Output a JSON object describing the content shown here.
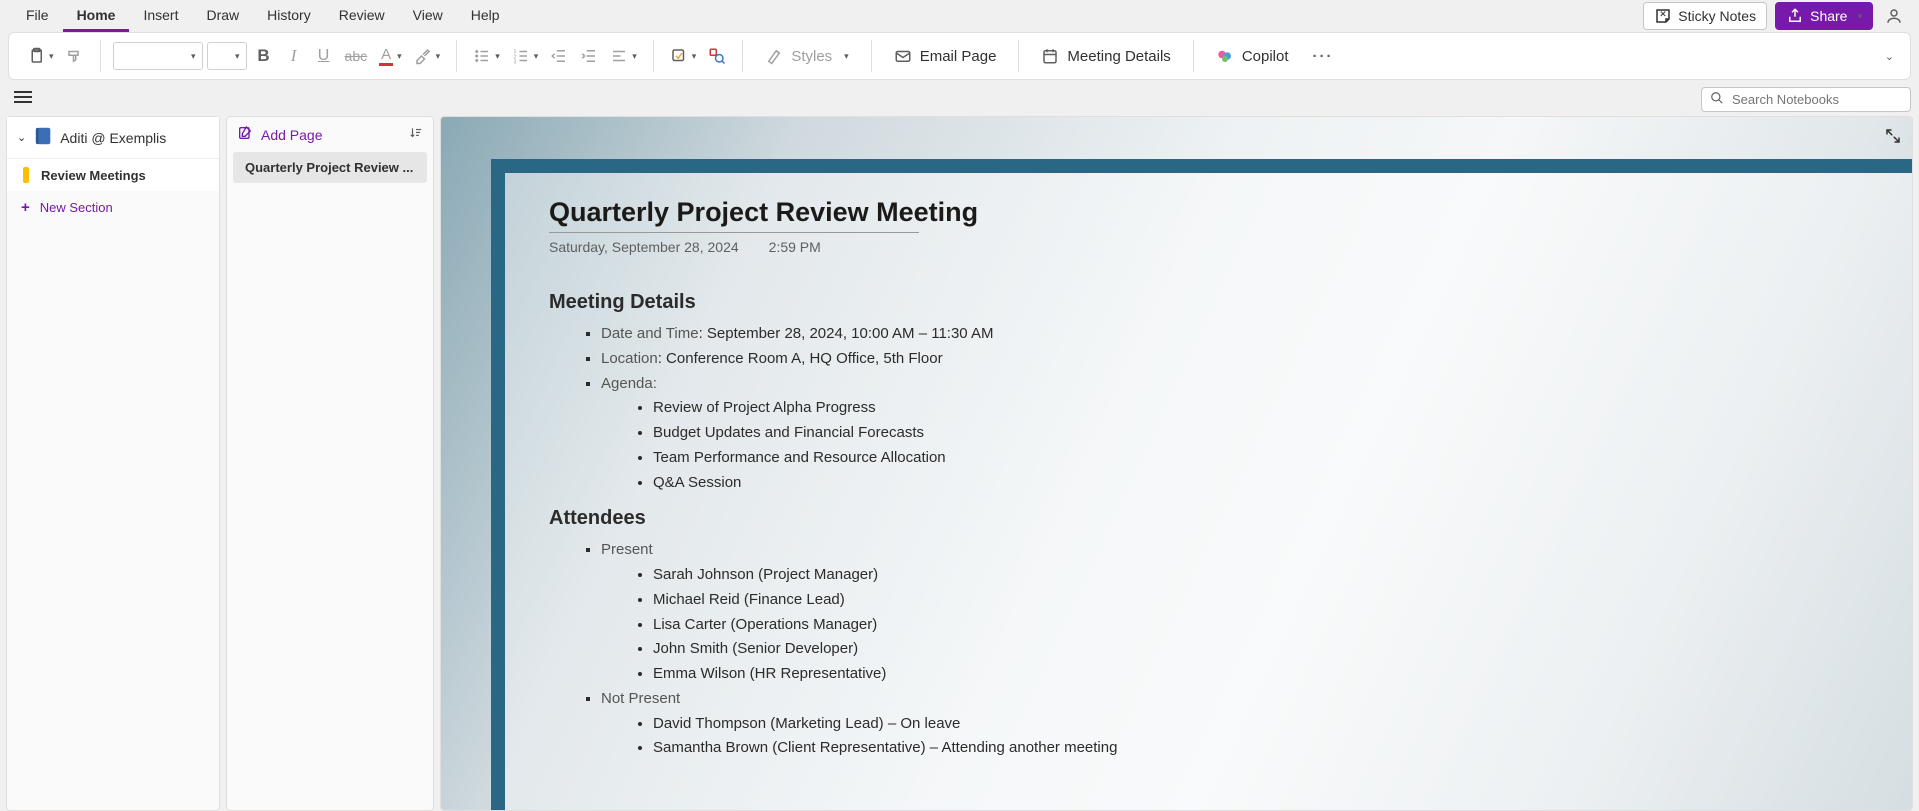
{
  "menu": {
    "file": "File",
    "home": "Home",
    "insert": "Insert",
    "draw": "Draw",
    "history": "History",
    "review": "Review",
    "view": "View",
    "help": "Help"
  },
  "titlebar": {
    "sticky": "Sticky Notes",
    "share": "Share"
  },
  "ribbon": {
    "styles": "Styles",
    "email": "Email Page",
    "meeting": "Meeting Details",
    "copilot": "Copilot"
  },
  "search": {
    "placeholder": "Search Notebooks"
  },
  "notebook": {
    "name": "Aditi @ Exemplis",
    "section": "Review Meetings",
    "new": "New Section"
  },
  "pagelist": {
    "add": "Add Page",
    "page1": "Quarterly Project Review ..."
  },
  "page": {
    "title": "Quarterly Project Review Meeting",
    "date": "Saturday, September 28, 2024",
    "time": "2:59 PM",
    "h_details": "Meeting Details",
    "dt_label": "Date and Time",
    "dt_value": ": September 28, 2024, 10:00 AM – 11:30 AM",
    "loc_label": "Location",
    "loc_value": ": Conference Room A, HQ Office, 5th Floor",
    "agenda_label": "Agenda:",
    "agenda": [
      "Review of Project Alpha Progress",
      "Budget Updates and Financial Forecasts",
      "Team Performance and Resource Allocation",
      "Q&A Session"
    ],
    "h_attendees": "Attendees",
    "present_label": "Present",
    "present": [
      "Sarah Johnson (Project Manager)",
      "Michael Reid (Finance Lead)",
      "Lisa Carter (Operations Manager)",
      "John Smith (Senior Developer)",
      "Emma Wilson (HR Representative)"
    ],
    "notpresent_label": "Not Present",
    "notpresent": [
      "David Thompson (Marketing Lead) – On leave",
      "Samantha Brown (Client Representative) – Attending another meeting"
    ]
  }
}
